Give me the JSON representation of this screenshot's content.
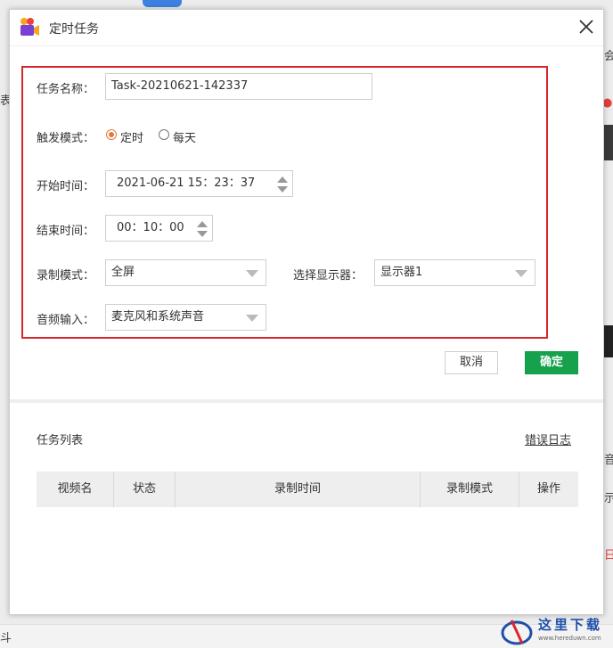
{
  "background": {
    "right_fragments": [
      "会",
      "西",
      "音",
      "示",
      "日"
    ],
    "left_fragments": [
      "表",
      "斗"
    ]
  },
  "dialog": {
    "title": "定时任务",
    "form": {
      "task_name_label": "任务名称：",
      "task_name_value": "Task-20210621-142337",
      "trigger_label": "触发模式：",
      "trigger_options": [
        {
          "label": "定时",
          "selected": true
        },
        {
          "label": "每天",
          "selected": false
        }
      ],
      "start_label": "开始时间：",
      "start_value": "2021-06-21 15：23：37",
      "end_label": "结束时间：",
      "end_value": "00：10：00",
      "record_mode_label": "录制模式：",
      "record_mode_value": "全屏",
      "display_label": "选择显示器：",
      "display_value": "显示器1",
      "audio_label": "音频输入：",
      "audio_value": "麦克风和系统声音"
    },
    "buttons": {
      "cancel": "取消",
      "ok": "确定"
    },
    "task_list": {
      "title": "任务列表",
      "error_log": "错误日志",
      "columns": [
        "视频名",
        "状态",
        "录制时间",
        "录制模式",
        "操作"
      ]
    }
  },
  "watermark": {
    "cn": "这里下载",
    "url": "www.hereduwn.com"
  },
  "colors": {
    "highlight_border": "#d9262c",
    "ok_button": "#16a14c",
    "radio_accent": "#e07a3c"
  }
}
